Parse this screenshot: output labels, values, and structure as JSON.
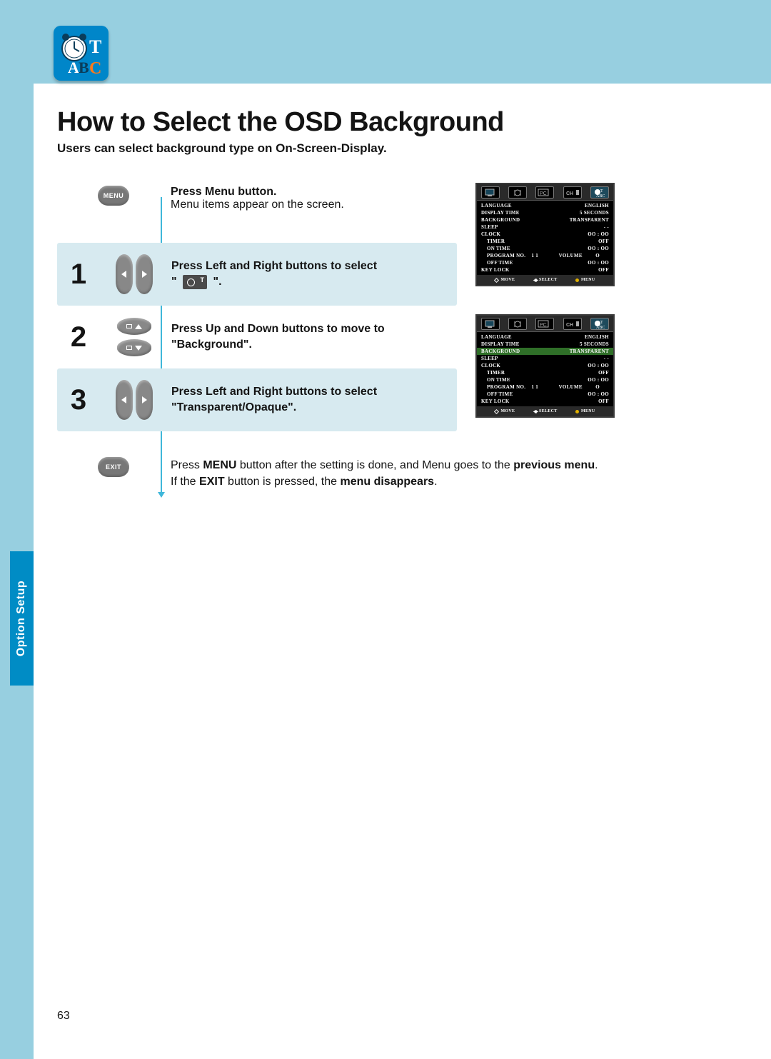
{
  "page": {
    "title": "How to Select the OSD Background",
    "subtitle": "Users can select background type on On-Screen-Display.",
    "number": "63",
    "section_tab": "Option Setup"
  },
  "intro": {
    "button_label": "MENU",
    "bold": "Press Menu button.",
    "plain": "Menu items appear on the screen."
  },
  "steps": [
    {
      "num": "1",
      "icon": "left-right",
      "text_pre": "Press Left and Right buttons to select",
      "text_quote_icon": true,
      "text_post": "."
    },
    {
      "num": "2",
      "icon": "up-down",
      "text": "Press Up and Down buttons to move to \"Background\"."
    },
    {
      "num": "3",
      "icon": "left-right",
      "text": "Press Left and Right buttons to select \"Transparent/Opaque\"."
    }
  ],
  "exit": {
    "button_label": "EXIT",
    "line1_pre": "Press ",
    "line1_b1": "MENU",
    "line1_mid": " button after the setting is done, and Menu goes to the ",
    "line1_b2": "previous menu",
    "line1_post": ".",
    "line2_pre": "If the ",
    "line2_b1": "EXIT",
    "line2_mid": " button is pressed, the ",
    "line2_b2": "menu disappears",
    "line2_post": "."
  },
  "osd": {
    "footer": {
      "move": "MOVE",
      "select": "SELECT",
      "menu": "MENU"
    },
    "rows": [
      {
        "l": "LANGUAGE",
        "r": "ENGLISH"
      },
      {
        "l": "DISPLAY TIME",
        "r": "5 SECONDS"
      },
      {
        "l": "BACKGROUND",
        "r": "TRANSPARENT",
        "hl_in_2": true
      },
      {
        "l": "SLEEP",
        "r": "- -"
      },
      {
        "l": "CLOCK",
        "r": "OO  :  OO"
      },
      {
        "l": "TIMER",
        "r": "OFF",
        "sub": true
      },
      {
        "l": "ON TIME",
        "r": "OO  :  OO",
        "sub": true
      },
      {
        "l": "PROGRAM NO.    1 1              VOLUME         O",
        "r": "",
        "sub": true,
        "mono": true
      },
      {
        "l": "OFF TIME",
        "r": "OO  :  OO",
        "sub": true
      },
      {
        "l": "KEY LOCK",
        "r": "OFF"
      }
    ]
  }
}
